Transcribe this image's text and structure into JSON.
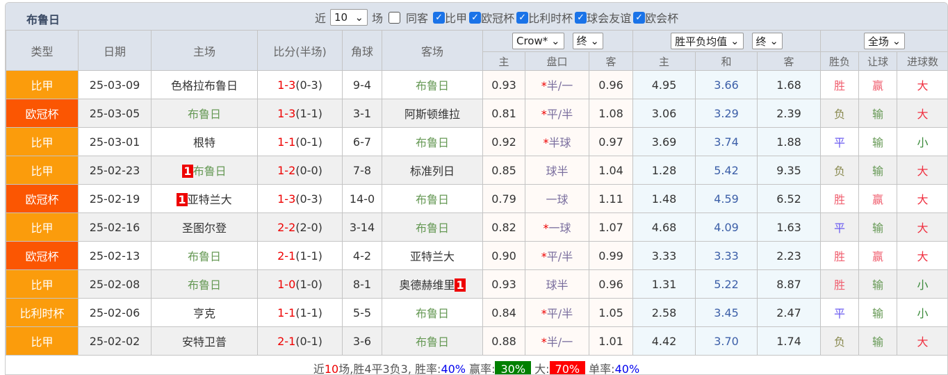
{
  "title": "布鲁日",
  "filters": {
    "near_label": "近",
    "count": "10",
    "field_label": "场",
    "same_label": "同客",
    "same_checked": false,
    "leagues": [
      {
        "label": "比甲",
        "checked": true
      },
      {
        "label": "欧冠杯",
        "checked": true
      },
      {
        "label": "比利时杯",
        "checked": true
      },
      {
        "label": "球会友谊",
        "checked": true
      },
      {
        "label": "欧会杯",
        "checked": true
      }
    ]
  },
  "headers": {
    "type": "类型",
    "date": "日期",
    "home": "主场",
    "score": "比分(半场)",
    "corner": "角球",
    "away": "客场",
    "company": "Crow*",
    "company_state": "终",
    "odds_type": "胜平负均值",
    "odds_state": "终",
    "scope": "全场",
    "sub": [
      "主",
      "盘口",
      "客",
      "主",
      "和",
      "客",
      "胜负",
      "让球",
      "进球数"
    ]
  },
  "colors": {
    "league_bijia": "#fb9c0c",
    "league_ucl": "#fb5602",
    "league_cup": "#fb9c0c"
  },
  "rows": [
    {
      "type": "比甲",
      "color": "#fb9c0c",
      "date": "25-03-09",
      "home": "色格拉布鲁日",
      "home_badge": "",
      "ft": "1-3",
      "ht": "(0-3)",
      "corner": "9-4",
      "away": "布鲁日",
      "away_badge": "",
      "o_h": "0.93",
      "hc": "半/一",
      "hc_star": "*",
      "o_a": "0.96",
      "e_h": "4.95",
      "e_d": "3.66",
      "e_a": "1.68",
      "res": "胜",
      "ah": "赢",
      "ou": "大",
      "brugge": "away"
    },
    {
      "type": "欧冠杯",
      "color": "#fb5602",
      "date": "25-03-05",
      "home": "布鲁日",
      "home_badge": "",
      "ft": "1-3",
      "ht": "(1-1)",
      "corner": "3-1",
      "away": "阿斯顿维拉",
      "away_badge": "",
      "o_h": "0.81",
      "hc": "平/半",
      "hc_star": "*",
      "o_a": "1.08",
      "e_h": "3.06",
      "e_d": "3.29",
      "e_a": "2.39",
      "res": "负",
      "ah": "输",
      "ou": "大",
      "brugge": "home"
    },
    {
      "type": "比甲",
      "color": "#fb9c0c",
      "date": "25-03-01",
      "home": "根特",
      "home_badge": "",
      "ft": "1-1",
      "ht": "(0-1)",
      "corner": "6-7",
      "away": "布鲁日",
      "away_badge": "",
      "o_h": "0.92",
      "hc": "半球",
      "hc_star": "*",
      "o_a": "0.97",
      "e_h": "3.69",
      "e_d": "3.74",
      "e_a": "1.88",
      "res": "平",
      "ah": "输",
      "ou": "小",
      "brugge": "away"
    },
    {
      "type": "比甲",
      "color": "#fb9c0c",
      "date": "25-02-23",
      "home": "布鲁日",
      "home_badge": "1",
      "ft": "1-2",
      "ht": "(0-0)",
      "corner": "7-8",
      "away": "标准列日",
      "away_badge": "",
      "o_h": "0.85",
      "hc": "球半",
      "hc_star": "",
      "o_a": "1.04",
      "e_h": "1.28",
      "e_d": "5.42",
      "e_a": "9.35",
      "res": "负",
      "ah": "输",
      "ou": "大",
      "brugge": "home"
    },
    {
      "type": "欧冠杯",
      "color": "#fb5602",
      "date": "25-02-19",
      "home": "亚特兰大",
      "home_badge": "1",
      "ft": "1-3",
      "ht": "(0-3)",
      "corner": "14-0",
      "away": "布鲁日",
      "away_badge": "",
      "o_h": "0.79",
      "hc": "一球",
      "hc_star": "",
      "o_a": "1.11",
      "e_h": "1.48",
      "e_d": "4.59",
      "e_a": "6.52",
      "res": "胜",
      "ah": "赢",
      "ou": "大",
      "brugge": "away"
    },
    {
      "type": "比甲",
      "color": "#fb9c0c",
      "date": "25-02-16",
      "home": "圣图尔登",
      "home_badge": "",
      "ft": "2-2",
      "ht": "(2-0)",
      "corner": "3-14",
      "away": "布鲁日",
      "away_badge": "",
      "o_h": "0.82",
      "hc": "一球",
      "hc_star": "*",
      "o_a": "1.07",
      "e_h": "4.68",
      "e_d": "4.09",
      "e_a": "1.63",
      "res": "平",
      "ah": "输",
      "ou": "大",
      "brugge": "away"
    },
    {
      "type": "欧冠杯",
      "color": "#fb5602",
      "date": "25-02-13",
      "home": "布鲁日",
      "home_badge": "",
      "ft": "2-1",
      "ht": "(1-1)",
      "corner": "4-2",
      "away": "亚特兰大",
      "away_badge": "",
      "o_h": "0.90",
      "hc": "平/半",
      "hc_star": "*",
      "o_a": "0.99",
      "e_h": "3.33",
      "e_d": "3.33",
      "e_a": "2.23",
      "res": "胜",
      "ah": "赢",
      "ou": "大",
      "brugge": "home"
    },
    {
      "type": "比甲",
      "color": "#fb9c0c",
      "date": "25-02-08",
      "home": "布鲁日",
      "home_badge": "",
      "ft": "1-0",
      "ht": "(1-0)",
      "corner": "8-1",
      "away": "奥德赫维里",
      "away_badge": "1",
      "o_h": "0.93",
      "hc": "球半",
      "hc_star": "",
      "o_a": "0.96",
      "e_h": "1.31",
      "e_d": "5.22",
      "e_a": "8.87",
      "res": "胜",
      "ah": "输",
      "ou": "小",
      "brugge": "home"
    },
    {
      "type": "比利时杯",
      "color": "#fb9c0c",
      "date": "25-02-06",
      "home": "亨克",
      "home_badge": "",
      "ft": "1-1",
      "ht": "(1-1)",
      "corner": "5-5",
      "away": "布鲁日",
      "away_badge": "",
      "o_h": "0.84",
      "hc": "平/半",
      "hc_star": "*",
      "o_a": "1.05",
      "e_h": "2.58",
      "e_d": "3.45",
      "e_a": "2.47",
      "res": "平",
      "ah": "输",
      "ou": "小",
      "brugge": "away"
    },
    {
      "type": "比甲",
      "color": "#fb9c0c",
      "date": "25-02-02",
      "home": "安特卫普",
      "home_badge": "",
      "ft": "2-1",
      "ht": "(0-1)",
      "corner": "3-6",
      "away": "布鲁日",
      "away_badge": "",
      "o_h": "0.88",
      "hc": "半/一",
      "hc_star": "*",
      "o_a": "1.01",
      "e_h": "4.42",
      "e_d": "3.70",
      "e_a": "1.74",
      "res": "负",
      "ah": "输",
      "ou": "大",
      "brugge": "away"
    }
  ],
  "footer": {
    "p1": "近",
    "n": "10",
    "p2": "场,胜4平3负3, 胜率:",
    "win_rate": "40%",
    "p3": " 赢率:",
    "ah_rate": "30%",
    "p4": " 大:",
    "over_rate": "70%",
    "p5": " 单率:",
    "odd_rate": "40%"
  }
}
